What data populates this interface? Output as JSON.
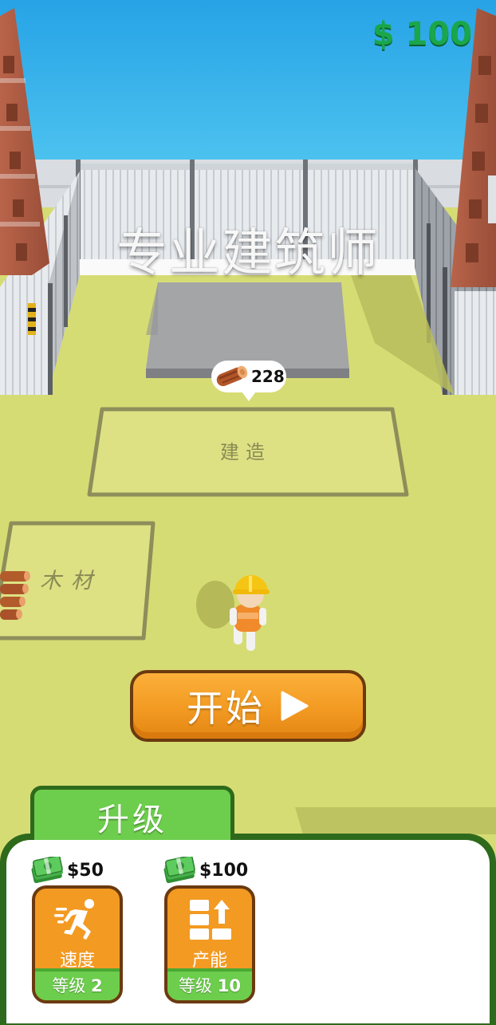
{
  "hud": {
    "money": "$ 100"
  },
  "title": "专业建筑师",
  "build_site": {
    "wood_required": "228",
    "label": "建造"
  },
  "wood_area": {
    "label": "木材"
  },
  "start_button": {
    "label": "开始"
  },
  "upgrade": {
    "tab_label": "升级",
    "items": [
      {
        "price": "$50",
        "name": "速度",
        "level_prefix": "等级",
        "level": "2",
        "icon": "running-man-icon"
      },
      {
        "price": "$100",
        "name": "产能",
        "level_prefix": "等级",
        "level": "10",
        "icon": "stack-boxes-up-icon"
      }
    ]
  },
  "colors": {
    "money": "#1aa64a",
    "button_orange": "#f39a22",
    "upgrade_green": "#6dcd4d",
    "panel_dark_green": "#2e6a1c",
    "ground": "#d6dc74",
    "sea": "#2aa8e6"
  }
}
